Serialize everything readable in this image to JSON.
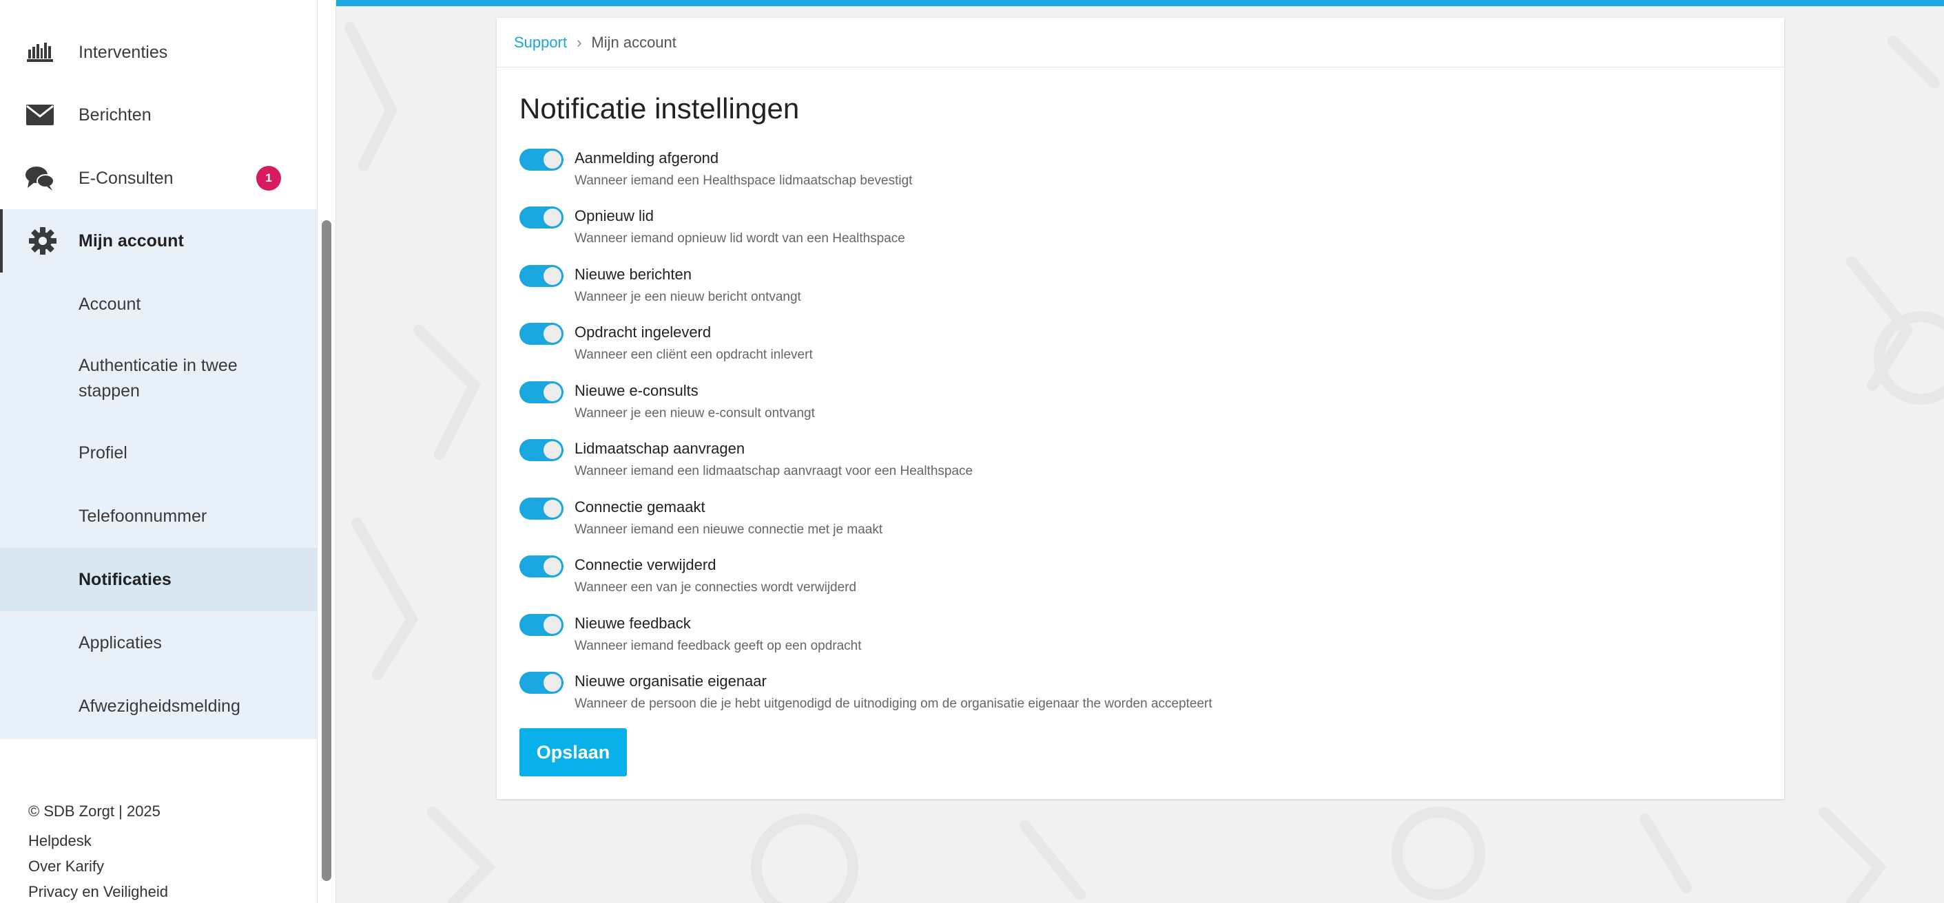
{
  "sidebar": {
    "items": [
      {
        "label": "Interventies",
        "icon": "bookshelf-icon"
      },
      {
        "label": "Berichten",
        "icon": "envelope-icon"
      },
      {
        "label": "E-Consulten",
        "icon": "chat-bubbles-icon",
        "badge": "1"
      },
      {
        "label": "Mijn account",
        "icon": "gear-icon"
      }
    ],
    "submenu": [
      {
        "label": "Account"
      },
      {
        "label": "Authenticatie in twee stappen"
      },
      {
        "label": "Profiel"
      },
      {
        "label": "Telefoonnummer"
      },
      {
        "label": "Notificaties"
      },
      {
        "label": "Applicaties"
      },
      {
        "label": "Afwezigheidsmelding"
      }
    ],
    "footer": {
      "copyright": "© SDB Zorgt | 2025",
      "links": [
        "Helpdesk",
        "Over Karify",
        "Privacy en Veiligheid"
      ]
    }
  },
  "breadcrumb": {
    "link": "Support",
    "current": "Mijn account"
  },
  "page": {
    "title": "Notificatie instellingen",
    "save_label": "Opslaan"
  },
  "settings": [
    {
      "title": "Aanmelding afgerond",
      "desc": "Wanneer iemand een Healthspace lidmaatschap bevestigt",
      "enabled": true
    },
    {
      "title": "Opnieuw lid",
      "desc": "Wanneer iemand opnieuw lid wordt van een Healthspace",
      "enabled": true
    },
    {
      "title": "Nieuwe berichten",
      "desc": "Wanneer je een nieuw bericht ontvangt",
      "enabled": true
    },
    {
      "title": "Opdracht ingeleverd",
      "desc": "Wanneer een cliënt een opdracht inlevert",
      "enabled": true
    },
    {
      "title": "Nieuwe e-consults",
      "desc": "Wanneer je een nieuw e-consult ontvangt",
      "enabled": true
    },
    {
      "title": "Lidmaatschap aanvragen",
      "desc": "Wanneer iemand een lidmaatschap aanvraagt voor een Healthspace",
      "enabled": true
    },
    {
      "title": "Connectie gemaakt",
      "desc": "Wanneer iemand een nieuwe connectie met je maakt",
      "enabled": true
    },
    {
      "title": "Connectie verwijderd",
      "desc": "Wanneer een van je connecties wordt verwijderd",
      "enabled": true
    },
    {
      "title": "Nieuwe feedback",
      "desc": "Wanneer iemand feedback geeft op een opdracht",
      "enabled": true
    },
    {
      "title": "Nieuwe organisatie eigenaar",
      "desc": "Wanneer de persoon die je hebt uitgenodigd de uitnodiging om de organisatie eigenaar the worden accepteert",
      "enabled": true
    }
  ],
  "colors": {
    "accent": "#1aa7e0",
    "badge": "#d81b60",
    "submenu_bg": "#e9f1f8",
    "submenu_active_bg": "#d9e7f2"
  }
}
